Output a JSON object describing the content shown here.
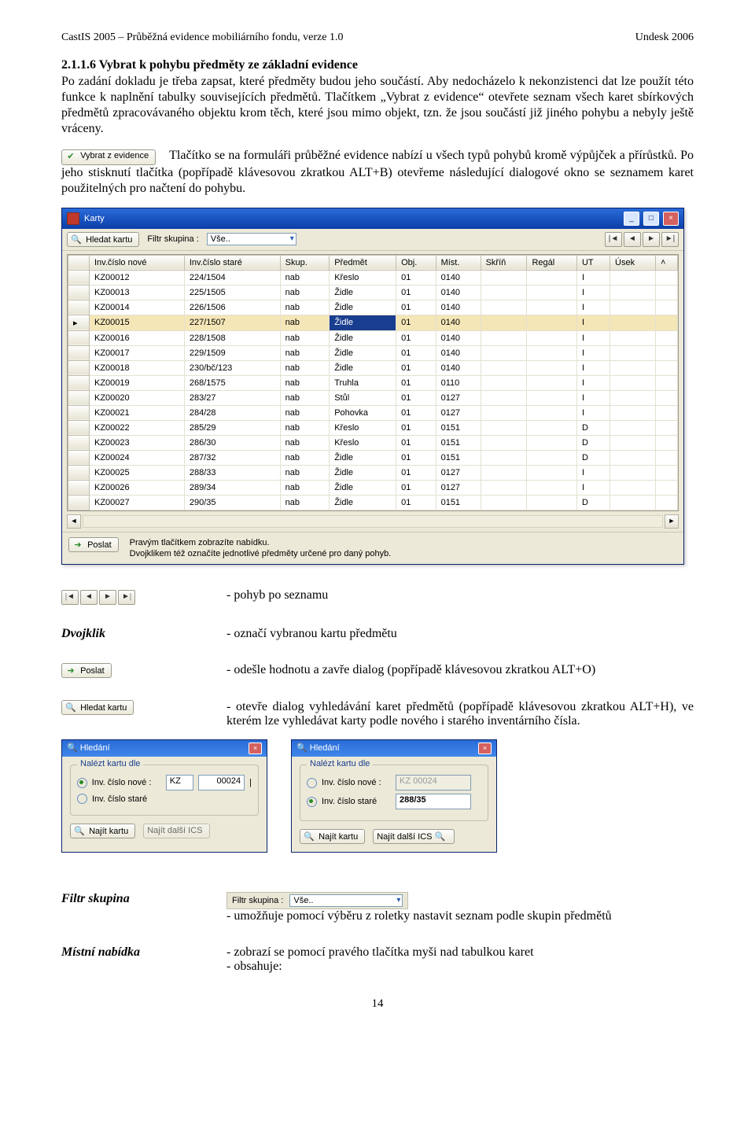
{
  "header": {
    "left": "CastIS 2005 – Průběžná evidence mobiliárního fondu, verze 1.0",
    "right": "Undesk 2006"
  },
  "section_title": "2.1.1.6 Vybrat k pohybu předměty ze základní evidence",
  "para1": "Po zadání dokladu je třeba zapsat, které předměty budou jeho součástí. Aby nedocházelo k nekonzistenci dat lze použít této funkce k naplnění tabulky souvisejících předmětů. Tlačítkem „Vybrat z evidence“ otevřete seznam všech karet sbírkových předmětů zpracovávaného objektu krom těch, které jsou mimo objekt, tzn. že jsou součástí již jiného pohybu a nebyly ještě vráceny.",
  "btn_vybrat": "Vybrat z evidence",
  "para2": "Tlačítko se na formuláři průběžné evidence nabízí u všech typů pohybů kromě výpůjček a přírůstků. Po jeho stisknutí tlačítka (popřípadě klávesovou zkratkou ALT+B) otevřeme následující dialogové okno se seznamem karet použitelných pro načtení do pohybu.",
  "karty_window": {
    "title": "Karty",
    "btn_hledat": "Hledat kartu",
    "filter_label": "Filtr skupina :",
    "filter_value": "Vše..",
    "columns": [
      "Inv.číslo nové",
      "Inv.číslo staré",
      "Skup.",
      "Předmět",
      "Obj.",
      "Míst.",
      "Skříň",
      "Regál",
      "UT",
      "Úsek"
    ],
    "rows": [
      {
        "c": [
          "KZ00012",
          "224/1504",
          "nab",
          "Křeslo",
          "01",
          "0140",
          "",
          "",
          "I",
          ""
        ]
      },
      {
        "c": [
          "KZ00013",
          "225/1505",
          "nab",
          "Židle",
          "01",
          "0140",
          "",
          "",
          "I",
          ""
        ]
      },
      {
        "c": [
          "KZ00014",
          "226/1506",
          "nab",
          "Židle",
          "01",
          "0140",
          "",
          "",
          "I",
          ""
        ]
      },
      {
        "c": [
          "KZ00015",
          "227/1507",
          "nab",
          "Židle",
          "01",
          "0140",
          "",
          "",
          "I",
          ""
        ],
        "sel": true,
        "selcol": 3
      },
      {
        "c": [
          "KZ00016",
          "228/1508",
          "nab",
          "Židle",
          "01",
          "0140",
          "",
          "",
          "I",
          ""
        ]
      },
      {
        "c": [
          "KZ00017",
          "229/1509",
          "nab",
          "Židle",
          "01",
          "0140",
          "",
          "",
          "I",
          ""
        ]
      },
      {
        "c": [
          "KZ00018",
          "230/bč/123",
          "nab",
          "Židle",
          "01",
          "0140",
          "",
          "",
          "I",
          ""
        ]
      },
      {
        "c": [
          "KZ00019",
          "268/1575",
          "nab",
          "Truhla",
          "01",
          "0110",
          "",
          "",
          "I",
          ""
        ]
      },
      {
        "c": [
          "KZ00020",
          "283/27",
          "nab",
          "Stůl",
          "01",
          "0127",
          "",
          "",
          "I",
          ""
        ]
      },
      {
        "c": [
          "KZ00021",
          "284/28",
          "nab",
          "Pohovka",
          "01",
          "0127",
          "",
          "",
          "I",
          ""
        ]
      },
      {
        "c": [
          "KZ00022",
          "285/29",
          "nab",
          "Křeslo",
          "01",
          "0151",
          "",
          "",
          "D",
          ""
        ]
      },
      {
        "c": [
          "KZ00023",
          "286/30",
          "nab",
          "Křeslo",
          "01",
          "0151",
          "",
          "",
          "D",
          ""
        ]
      },
      {
        "c": [
          "KZ00024",
          "287/32",
          "nab",
          "Židle",
          "01",
          "0151",
          "",
          "",
          "D",
          ""
        ]
      },
      {
        "c": [
          "KZ00025",
          "288/33",
          "nab",
          "Židle",
          "01",
          "0127",
          "",
          "",
          "I",
          ""
        ]
      },
      {
        "c": [
          "KZ00026",
          "289/34",
          "nab",
          "Židle",
          "01",
          "0127",
          "",
          "",
          "I",
          ""
        ]
      },
      {
        "c": [
          "KZ00027",
          "290/35",
          "nab",
          "Židle",
          "01",
          "0151",
          "",
          "",
          "D",
          ""
        ]
      }
    ],
    "btn_poslat": "Poslat",
    "footer1": "Pravým tlačítkem zobrazíte nabídku.",
    "footer2": "Dvojklikem též označíte jednotlivé předměty určené pro daný pohyb."
  },
  "legend": {
    "nav": "- pohyb po seznamu",
    "dvojklik_label": "Dvojklik",
    "dvojklik": "- označí vybranou kartu předmětu",
    "poslat_btn": "Poslat",
    "poslat": "- odešle hodnotu a zavře dialog (popřípadě klávesovou zkratkou ALT+O)",
    "hledat_btn": "Hledat kartu",
    "hledat": "- otevře dialog vyhledávání karet předmětů (popřípadě klávesovou zkratkou ALT+H), ve kterém lze vyhledávat karty podle nového i starého inventárního čísla."
  },
  "dialogs": {
    "title": "Hledání",
    "group": "Nalézt kartu dle",
    "opt1": "Inv. číslo nové :",
    "opt2": "Inv. číslo staré",
    "left_prefix": "KZ",
    "left_num": "00024",
    "right_num": "288/35",
    "right_nove_placeholder": "KZ    00024",
    "btn1": "Najít kartu",
    "btn2": "Najít další  ICS"
  },
  "bottom": {
    "filtr_label": "Filtr skupina",
    "filtr_text": "- umožňuje pomocí výběru z roletky nastavit seznam podle skupin předmětů",
    "filtr_strip_label": "Filtr skupina :",
    "filtr_strip_value": "Vše..",
    "mistni_label": "Místní nabídka",
    "mistni_l1": "- zobrazí se pomocí pravého tlačítka myši nad tabulkou karet",
    "mistni_l2": "- obsahuje:"
  },
  "page_number": "14"
}
